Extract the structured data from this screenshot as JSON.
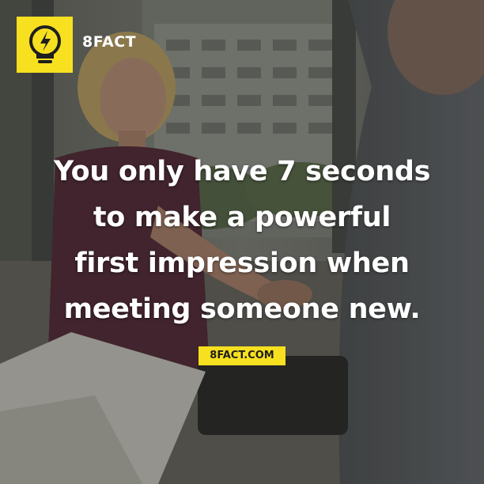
{
  "brand": {
    "name": "8FACT",
    "accent_color": "#f7e01f",
    "icon": "lightbulb-lightning-icon"
  },
  "headline": {
    "lines": [
      "You only have 7 seconds",
      "to make a powerful",
      "first impression when",
      "meeting someone new."
    ]
  },
  "footer": {
    "source": "8FACT.COM"
  },
  "background": {
    "description_icon": "handshake-photo"
  }
}
